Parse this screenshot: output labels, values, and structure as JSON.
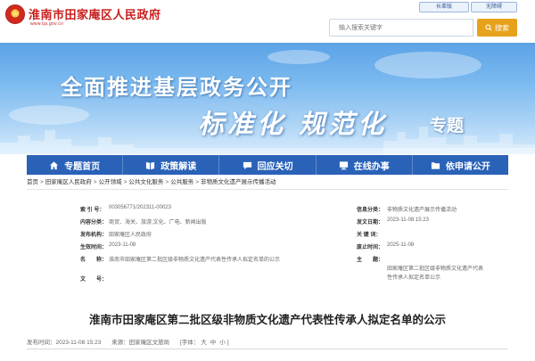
{
  "header": {
    "site_name": "淮南市田家庵区人民政府",
    "site_url": "www.tja.gov.cn",
    "elder_mode": "长辈版",
    "accessible": "无障碍",
    "search_placeholder": "输入搜索关键字",
    "search_button": "搜索"
  },
  "banner": {
    "title": "全面推进基层政务公开",
    "subtitle_art": "标准化 规范化",
    "subtitle_tail": "专题"
  },
  "nav": {
    "items": [
      {
        "label": "专题首页",
        "icon": "home-icon"
      },
      {
        "label": "政策解读",
        "icon": "book-icon"
      },
      {
        "label": "回应关切",
        "icon": "chat-icon"
      },
      {
        "label": "在线办事",
        "icon": "computer-icon"
      },
      {
        "label": "依申请公开",
        "icon": "folder-icon"
      }
    ]
  },
  "breadcrumb": [
    "首页",
    "田家庵区人民政府",
    "公开领域",
    "公共文化服务",
    "公共服务",
    "非物质文化遗产展示传播活动"
  ],
  "breadcrumb_sep": ">",
  "info": {
    "index_no_label": "索 引 号：",
    "index_no": "003056771/202311-00023",
    "category_label": "信息分类：",
    "category": "非物质文化遗产展示传播活动",
    "content_label": "内容分类：",
    "content": "商贸、海关、旅游;文化、广电、新闻出版",
    "date_label": "发文日期：",
    "date": "2023-11-08 15:23",
    "org_label": "发布机构：",
    "org": "田家庵区人民政府",
    "keyword_label": "关 键 词：",
    "keyword": "",
    "effective_label": "生效时间：",
    "effective": "2023-11-08",
    "expire_label": "废止时间：",
    "expire": "2025-11-08",
    "name_label": "名　　称：",
    "name": "淮南市田家庵区第二批区级非物质文化遗产代表性传承人拟定名单的公示",
    "summary_label": "主　　题：",
    "summary": "田家庵区第二批区级非物质文化遗产代表性传承人拟定名单公示",
    "docno_label": "文　　号："
  },
  "article": {
    "title": "淮南市田家庵区第二批区级非物质文化遗产代表性传承人拟定名单的公示",
    "publish_label": "发布时间：",
    "publish_time": "2023-11-08 15:23",
    "source_label": "来源：",
    "source": "田家庵区文旅局",
    "font_label": "[字体：",
    "font_large": "大",
    "font_medium": "中",
    "font_small": "小",
    "font_close": "]"
  },
  "colors": {
    "brand_red": "#c81e1e",
    "nav_blue": "#2a62b8",
    "search_orange": "#e7a21b"
  }
}
